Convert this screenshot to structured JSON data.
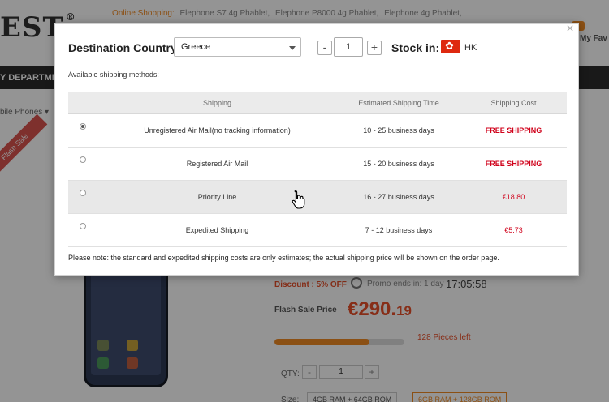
{
  "background": {
    "logo_text": "EST",
    "hot_search": {
      "label": "Online Shopping:",
      "links": [
        "Elephone S7 4g Phablet,",
        "Elephone P8000 4g Phablet,",
        "Elephone 4g Phablet,"
      ]
    },
    "my_fav": "My Fav",
    "nav_departments": "Y DEPARTMEN",
    "breadcrumb": "bile Phones",
    "flash_ribbon": "Flash Sale",
    "discount_text": "Discount : 5% OFF",
    "promo_ends": "Promo ends in:",
    "promo_day": "1 day",
    "promo_time": "17:05:58",
    "flash_sale_label": "Flash Sale Price",
    "flash_price_main": "€290.",
    "flash_price_cents": "19",
    "sold_progress_percent": 73,
    "pieces_left": "128 Pieces left",
    "qty_label": "QTY:",
    "qty_value": "1",
    "size_label": "Size:",
    "size_options": [
      "4GB RAM + 64GB ROM",
      "6GB RAM + 128GB ROM"
    ]
  },
  "modal": {
    "close_glyph": "×",
    "destination_label": "Destination Country:",
    "destination_value": "Greece",
    "qty_minus": "-",
    "qty_value": "1",
    "qty_plus": "+",
    "stock_label": "Stock in:",
    "stock_country": "HK",
    "available_label": "Available shipping methods:",
    "table": {
      "headers": {
        "shipping": "Shipping",
        "eta": "Estimated Shipping Time",
        "cost": "Shipping Cost"
      },
      "rows": [
        {
          "method": "Unregistered Air Mail(no tracking information)",
          "eta": "10 - 25 business days",
          "cost": "FREE SHIPPING",
          "selected": true
        },
        {
          "method": "Registered Air Mail",
          "eta": "15 - 20 business days",
          "cost": "FREE SHIPPING",
          "selected": false
        },
        {
          "method": "Priority Line",
          "eta": "16 - 27 business days",
          "cost": "€18.80",
          "selected": false
        },
        {
          "method": "Expedited Shipping",
          "eta": "7 - 12 business days",
          "cost": "€5.73",
          "selected": false
        }
      ]
    },
    "note": "Please note: the standard and expedited shipping costs are only estimates; the actual shipping price will be shown on the order page."
  },
  "colors": {
    "accent_red": "#d0021b",
    "brand_orange": "#f08a24",
    "flag_red": "#de2910"
  }
}
